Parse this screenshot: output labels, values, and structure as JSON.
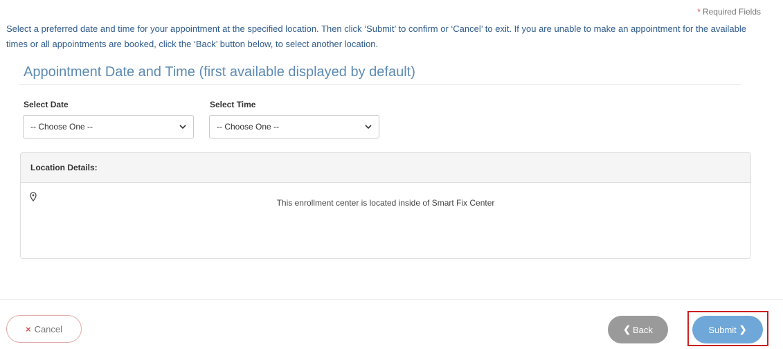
{
  "required_note": {
    "star": "*",
    "text": "Required Fields"
  },
  "instructions": "Select a preferred date and time for your appointment at the specified location. Then click ‘Submit’ to confirm or ‘Cancel’ to exit. If you are unable to make an appointment for the available times or all appointments are booked, click the ‘Back’ button below, to select another location.",
  "section_title": "Appointment Date and Time (first available displayed by default)",
  "date_field": {
    "label": "Select Date",
    "selected": "-- Choose One --"
  },
  "time_field": {
    "label": "Select Time",
    "selected": "-- Choose One --"
  },
  "location_panel": {
    "header": "Location Details:",
    "icon": "map-marker-icon",
    "description": "This enrollment center is located inside of Smart Fix Center"
  },
  "buttons": {
    "cancel_icon": "×",
    "cancel_label": "Cancel",
    "back_icon": "❮",
    "back_label": "Back",
    "submit_label": "Submit",
    "submit_icon": "❯"
  },
  "colors": {
    "instruction_text": "#2f5b8c",
    "section_title": "#5c8ab5",
    "submit_button": "#6fa7d8",
    "back_button": "#9a9a9a",
    "cancel_accent": "#d9534f",
    "highlight": "#cc1f1f"
  }
}
